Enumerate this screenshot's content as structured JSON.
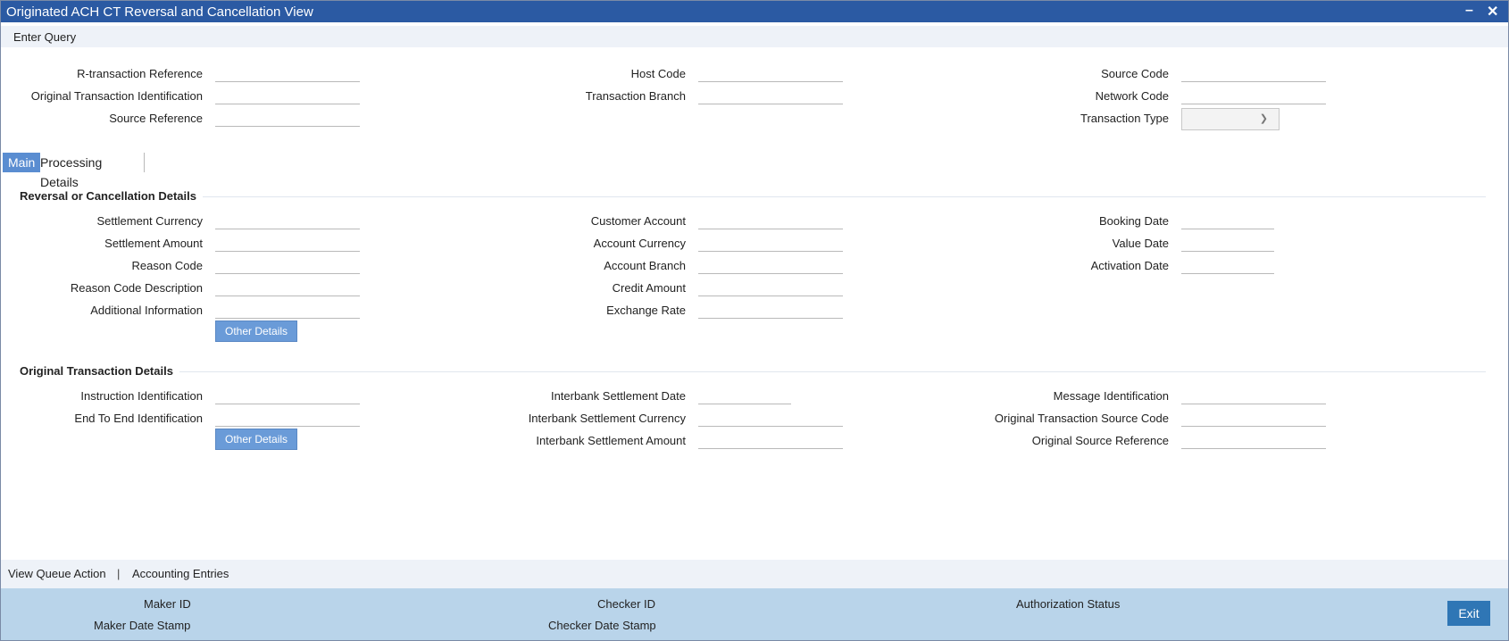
{
  "window": {
    "title": "Originated ACH CT Reversal and Cancellation View",
    "minimize": "–",
    "close": "✕"
  },
  "menu": {
    "enter_query": "Enter Query"
  },
  "header": {
    "r_transaction_reference": "R-transaction Reference",
    "original_transaction_identification": "Original Transaction Identification",
    "source_reference": "Source Reference",
    "host_code": "Host Code",
    "transaction_branch": "Transaction Branch",
    "source_code": "Source Code",
    "network_code": "Network Code",
    "transaction_type": "Transaction Type",
    "transaction_type_value": ""
  },
  "tabs": {
    "main": "Main",
    "processing_details": "Processing Details"
  },
  "reversal": {
    "title": "Reversal or Cancellation Details",
    "settlement_currency": "Settlement Currency",
    "settlement_amount": "Settlement Amount",
    "reason_code": "Reason Code",
    "reason_code_description": "Reason Code Description",
    "additional_information": "Additional Information",
    "other_details": "Other Details",
    "customer_account": "Customer Account",
    "account_currency": "Account Currency",
    "account_branch": "Account Branch",
    "credit_amount": "Credit Amount",
    "exchange_rate": "Exchange Rate",
    "booking_date": "Booking Date",
    "value_date": "Value Date",
    "activation_date": "Activation Date"
  },
  "original": {
    "title": "Original Transaction Details",
    "instruction_identification": "Instruction Identification",
    "end_to_end_identification": "End To End Identification",
    "other_details": "Other Details",
    "interbank_settlement_date": "Interbank Settlement Date",
    "interbank_settlement_currency": "Interbank Settlement Currency",
    "interbank_settlement_amount": "Interbank Settlement Amount",
    "message_identification": "Message Identification",
    "original_transaction_source_code": "Original Transaction Source Code",
    "original_source_reference": "Original Source Reference"
  },
  "footer": {
    "view_queue_action": "View Queue Action",
    "separator": "|",
    "accounting_entries": "Accounting Entries",
    "maker_id": "Maker ID",
    "maker_date_stamp": "Maker Date Stamp",
    "checker_id": "Checker ID",
    "checker_date_stamp": "Checker Date Stamp",
    "authorization_status": "Authorization Status",
    "exit": "Exit"
  }
}
